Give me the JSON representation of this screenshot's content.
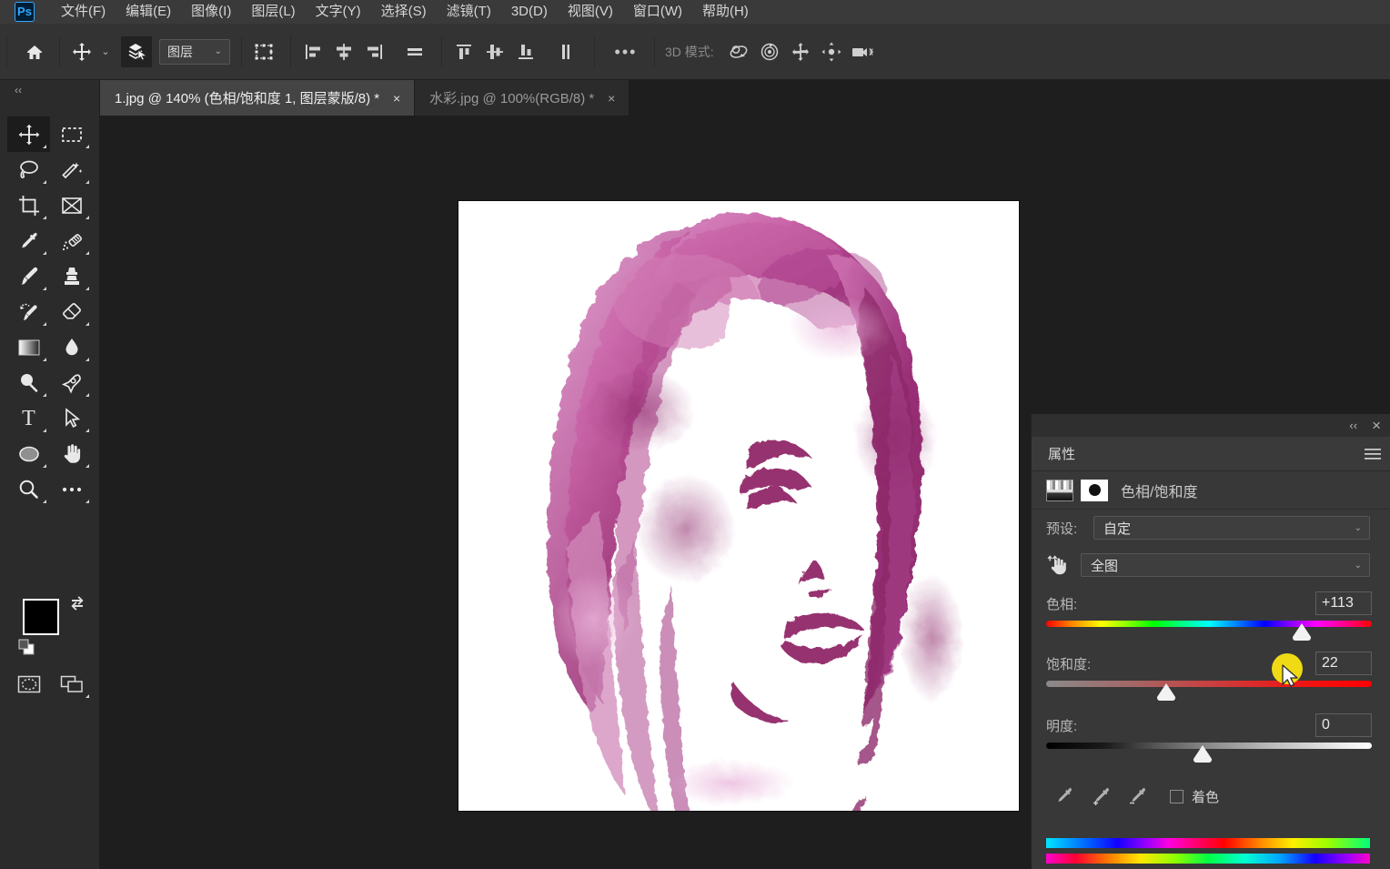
{
  "app": {
    "name": "Adobe Photoshop",
    "logo_text": "Ps"
  },
  "menubar": {
    "items": [
      {
        "label": "文件(F)",
        "name": "menu-file"
      },
      {
        "label": "编辑(E)",
        "name": "menu-edit"
      },
      {
        "label": "图像(I)",
        "name": "menu-image"
      },
      {
        "label": "图层(L)",
        "name": "menu-layer"
      },
      {
        "label": "文字(Y)",
        "name": "menu-type"
      },
      {
        "label": "选择(S)",
        "name": "menu-select"
      },
      {
        "label": "滤镜(T)",
        "name": "menu-filter"
      },
      {
        "label": "3D(D)",
        "name": "menu-3d"
      },
      {
        "label": "视图(V)",
        "name": "menu-view"
      },
      {
        "label": "窗口(W)",
        "name": "menu-window"
      },
      {
        "label": "帮助(H)",
        "name": "menu-help"
      }
    ]
  },
  "optionsbar": {
    "home_icon": "home-icon",
    "move_tool_icon": "move-tool-icon",
    "auto_select_chevron": "chevron-down-icon",
    "layers_toggle_icon": "auto-select-layers-icon",
    "auto_select_target": "图层",
    "transform_controls_icon": "show-transform-controls-icon",
    "align_icons": [
      "align-left-edges-icon",
      "align-horizontal-centers-icon",
      "align-right-edges-icon",
      "distribute-horizontally-icon",
      "align-top-edges-icon",
      "align-vertical-centers-icon",
      "align-bottom-edges-icon",
      "distribute-vertically-icon"
    ],
    "more_label": "•••",
    "mode_3d_label": "3D 模式:",
    "mode_3d_icons": [
      "orbit-3d-icon",
      "roll-3d-icon",
      "pan-3d-icon",
      "slide-3d-icon",
      "zoom-camera-3d-icon"
    ]
  },
  "tabs": [
    {
      "label": "1.jpg @ 140% (色相/饱和度 1, 图层蒙版/8) *",
      "active": true,
      "close": "×"
    },
    {
      "label": "水彩.jpg @ 100%(RGB/8) *",
      "active": false,
      "close": "×"
    }
  ],
  "toolbar": {
    "collapse_label": "‹‹",
    "tools": [
      {
        "name": "move-tool",
        "icon": "move-icon",
        "active": true
      },
      {
        "name": "rectangular-marquee-tool",
        "icon": "marquee-icon",
        "active": false
      },
      {
        "name": "lasso-tool",
        "icon": "lasso-icon",
        "active": false
      },
      {
        "name": "object-selection-tool",
        "icon": "magic-wand-icon",
        "active": false
      },
      {
        "name": "crop-tool",
        "icon": "crop-icon",
        "active": false
      },
      {
        "name": "frame-tool",
        "icon": "frame-icon",
        "active": false
      },
      {
        "name": "eyedropper-tool",
        "icon": "eyedropper-icon",
        "active": false
      },
      {
        "name": "spot-healing-brush-tool",
        "icon": "healing-brush-icon",
        "active": false
      },
      {
        "name": "brush-tool",
        "icon": "brush-icon",
        "active": false
      },
      {
        "name": "clone-stamp-tool",
        "icon": "clone-stamp-icon",
        "active": false
      },
      {
        "name": "history-brush-tool",
        "icon": "history-brush-icon",
        "active": false
      },
      {
        "name": "eraser-tool",
        "icon": "eraser-icon",
        "active": false
      },
      {
        "name": "gradient-tool",
        "icon": "gradient-icon",
        "active": false
      },
      {
        "name": "blur-tool",
        "icon": "blur-drop-icon",
        "active": false
      },
      {
        "name": "dodge-tool",
        "icon": "dodge-icon",
        "active": false
      },
      {
        "name": "pen-tool",
        "icon": "pen-icon",
        "active": false
      },
      {
        "name": "horizontal-type-tool",
        "icon": "type-t-icon",
        "active": false
      },
      {
        "name": "path-selection-tool",
        "icon": "path-arrow-icon",
        "active": false
      },
      {
        "name": "ellipse-tool",
        "icon": "ellipse-icon",
        "active": false
      },
      {
        "name": "hand-tool",
        "icon": "hand-icon",
        "active": false
      },
      {
        "name": "zoom-tool",
        "icon": "magnifier-icon",
        "active": false
      },
      {
        "name": "edit-toolbar",
        "icon": "more-dots-icon",
        "active": false
      }
    ],
    "foreground_color": "#000000",
    "background_color": "#ffffff",
    "swap_icon": "swap-colors-icon",
    "default_colors_icon": "default-colors-icon",
    "quick_mask_icon": "quick-mask-icon",
    "screen_mode_icon": "screen-mode-icon"
  },
  "properties": {
    "collapse_icon": "‹‹",
    "close_icon": "×",
    "tab_label": "属性",
    "menu_icon": "panel-menu-icon",
    "adjustment_title": "色相/饱和度",
    "adjustment_thumb_icon": "hue-saturation-thumbnail-icon",
    "mask_thumb_icon": "layer-mask-thumbnail-icon",
    "preset_label": "预设:",
    "preset_value": "自定",
    "targeted_adjust_icon": "targeted-adjustment-tool-icon",
    "channel_value": "全图",
    "sliders": [
      {
        "name": "hue",
        "label": "色相:",
        "value": "+113",
        "position_pct": 78.5,
        "track": "hue"
      },
      {
        "name": "saturation",
        "label": "饱和度:",
        "value": "22",
        "position_pct": 37.0,
        "track": "sat"
      },
      {
        "name": "lightness",
        "label": "明度:",
        "value": "0",
        "position_pct": 48.0,
        "track": "light"
      }
    ],
    "eyedroppers": [
      {
        "name": "sample-color-eyedropper",
        "icon": "eyedropper-icon"
      },
      {
        "name": "add-to-sample-eyedropper",
        "icon": "eyedropper-plus-icon"
      },
      {
        "name": "subtract-from-sample-eyedropper",
        "icon": "eyedropper-minus-icon"
      }
    ],
    "colorize_label": "着色",
    "colorize_checked": false
  },
  "cursor": {
    "type": "arrow-cursor",
    "highlight_color": "#ffe812"
  }
}
